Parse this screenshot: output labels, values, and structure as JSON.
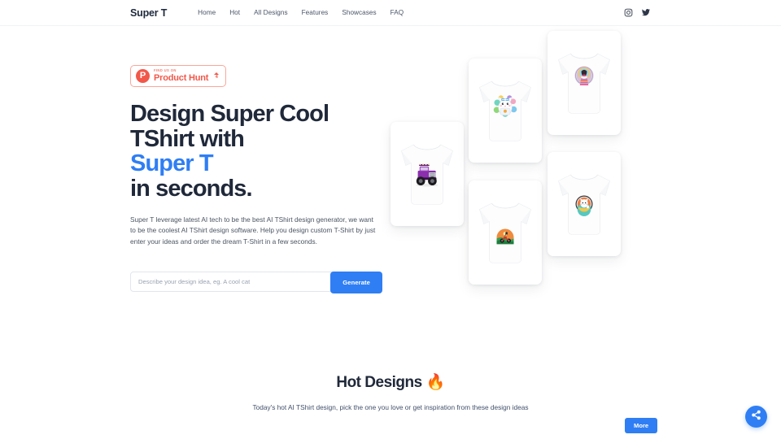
{
  "header": {
    "brand": "Super T",
    "nav": [
      {
        "label": "Home",
        "name": "nav-home"
      },
      {
        "label": "Hot",
        "name": "nav-hot"
      },
      {
        "label": "All Designs",
        "name": "nav-all-designs"
      },
      {
        "label": "Features",
        "name": "nav-features"
      },
      {
        "label": "Showcases",
        "name": "nav-showcases"
      },
      {
        "label": "FAQ",
        "name": "nav-faq"
      }
    ],
    "social": [
      {
        "name": "instagram-icon",
        "label": "Instagram"
      },
      {
        "name": "twitter-icon",
        "label": "Twitter"
      }
    ]
  },
  "hero": {
    "product_hunt": {
      "small_text": "FIND US ON",
      "name": "Product Hunt",
      "vote_count": "4",
      "logo_letter": "P",
      "color": "#f2584a"
    },
    "headline": {
      "line1": "Design Super Cool",
      "line2": "TShirt with",
      "accent": "Super T",
      "line4": "in seconds."
    },
    "paragraph": "Super T leverage latest AI tech to be the best AI TShirt design generator, we want to be the coolest AI TShirt design software. Help you design custom T-Shirt by just enter your ideas and order the dream T-Shirt in a few seconds.",
    "search": {
      "placeholder": "Describe your design idea, eg. A cool cat",
      "value": "",
      "button_label": "Generate"
    },
    "accent_color": "#2f7ef4",
    "showcase": [
      {
        "name": "tshirt-card-monster-truck",
        "design": "purple monster truck"
      },
      {
        "name": "tshirt-card-nurse-cat",
        "design": "white cat nurse with flowers"
      },
      {
        "name": "tshirt-card-girl-mandala",
        "design": "girl in colorful dress with halo"
      },
      {
        "name": "tshirt-card-motorcycle",
        "design": "motorcycle in round badge"
      },
      {
        "name": "tshirt-card-round-cat",
        "design": "cat in round orange frame"
      }
    ]
  },
  "hot": {
    "title": "Hot Designs 🔥",
    "subtitle": "Today's hot AI TShirt design, pick the one you love or get inspiration from these design ideas",
    "more_label": "More"
  },
  "fab": {
    "name": "share-fab",
    "label": "Share"
  }
}
